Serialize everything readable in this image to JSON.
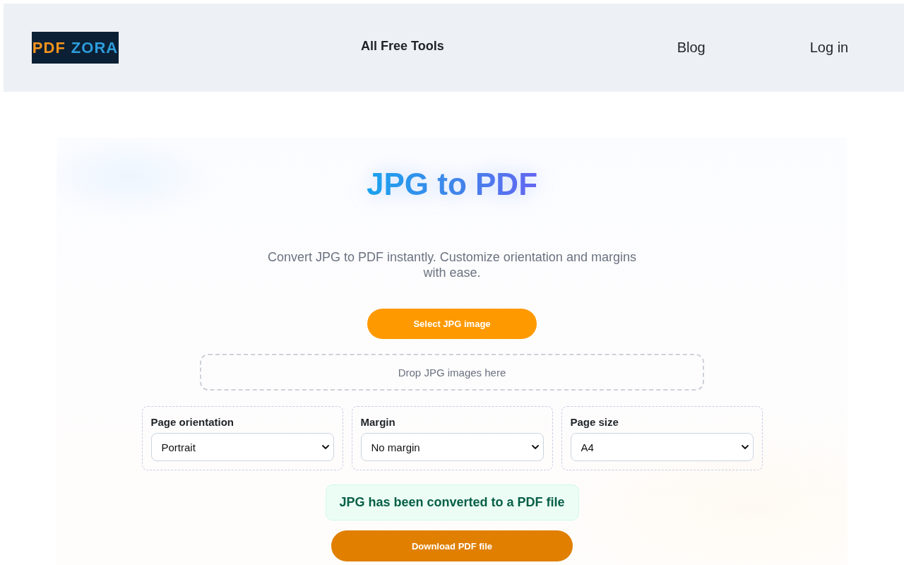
{
  "header": {
    "logo": {
      "part_1": "PDF",
      "part_2": "ZORA"
    },
    "nav": [
      {
        "label": "All Free Tools",
        "kind": "menu"
      },
      {
        "label": "Blog",
        "kind": "link"
      },
      {
        "label": "Log in",
        "kind": "link"
      }
    ]
  },
  "tool": {
    "title": "JPG to PDF",
    "subtitle": "Convert JPG to PDF instantly. Customize orientation and margins with ease.",
    "select_button": "Select JPG image",
    "drop_zone": "Drop JPG images here",
    "options": [
      {
        "label": "Page orientation",
        "value": "Portrait"
      },
      {
        "label": "Margin",
        "value": "No margin"
      },
      {
        "label": "Page size",
        "value": "A4"
      }
    ],
    "status": "JPG has been converted to a PDF file",
    "download_button": "Download PDF file"
  }
}
